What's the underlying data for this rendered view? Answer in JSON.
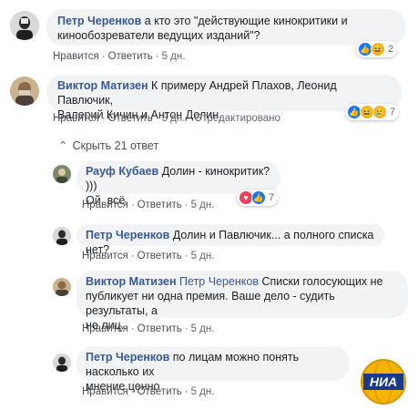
{
  "comments": [
    {
      "author": "Петр Черенков",
      "text_lines": [
        "а кто это \"действующие кинокритики и",
        "кинообозреватели ведущих изданий\"?"
      ],
      "reaction_count": "2",
      "actions": {
        "like": "Нравится",
        "reply": "Ответить",
        "time": "5 дн."
      }
    },
    {
      "author": "Виктор Матизен",
      "text_lines": [
        "К примеру Андрей Плахов, Леонид Павлючик,",
        "Валерий Кичин и Антон Долин."
      ],
      "reaction_count": "7",
      "actions": {
        "like": "Нравится",
        "reply": "Ответить",
        "time": "5 дн.",
        "edited": "Отредактировано"
      }
    }
  ],
  "hide_replies": "Скрыть 21 ответ",
  "replies": [
    {
      "author": "Рауф Кубаев",
      "text_lines": [
        "Долин - кинокритик? )))",
        "Ой, всё."
      ],
      "reaction_count": "7",
      "actions": {
        "like": "Нравится",
        "reply": "Ответить",
        "time": "5 дн."
      }
    },
    {
      "author": "Петр Черенков",
      "text_lines": [
        "Долин и Павлючик... а полного списка нет?"
      ],
      "actions": {
        "like": "Нравится",
        "reply": "Ответить",
        "time": "5 дн."
      }
    },
    {
      "author": "Виктор Матизен",
      "mention": "Петр Черенков",
      "text_lines": [
        "Списки голосующих не",
        "публикует ни одна премия. Ваше дело - судить результаты, а",
        "не лиц.."
      ],
      "actions": {
        "like": "Нравится",
        "reply": "Ответить",
        "time": "5 дн."
      }
    },
    {
      "author": "Петр Черенков",
      "text_lines": [
        "по лицам можно понять насколько их",
        "мнение ценно"
      ],
      "actions": {
        "like": "Нравится",
        "reply": "Ответить",
        "time": "5 дн."
      }
    }
  ],
  "watermark": "НИА",
  "colors": {
    "link": "#385898",
    "bubble": "#f2f3f5",
    "meta": "#606770"
  }
}
